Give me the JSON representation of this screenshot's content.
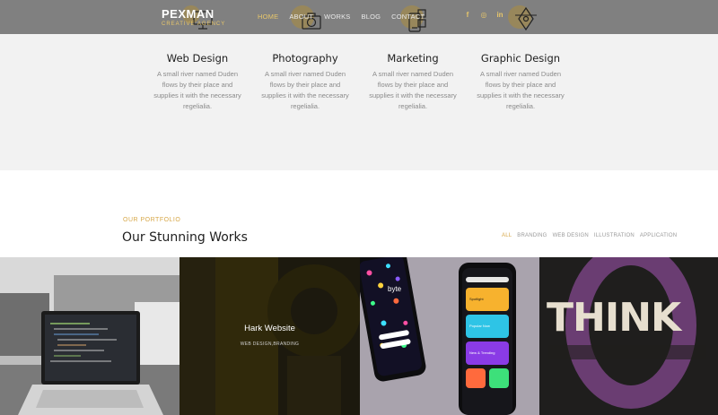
{
  "header": {
    "brand_name": "PEXMAN",
    "brand_tagline": "CREATIVE AGENCY",
    "nav": [
      "HOME",
      "ABOUT",
      "WORKS",
      "BLOG",
      "CONTACT"
    ],
    "social_icons": [
      "facebook-icon",
      "instagram-icon",
      "linkedin-icon"
    ],
    "social_glyphs": [
      "f",
      "◎",
      "in"
    ]
  },
  "services": [
    {
      "title": "Web Design",
      "text": "A small river named Duden flows by their place and supplies it with the necessary regelialia."
    },
    {
      "title": "Photography",
      "text": "A small river named Duden flows by their place and supplies it with the necessary regelialia."
    },
    {
      "title": "Marketing",
      "text": "A small river named Duden flows by their place and supplies it with the necessary regelialia."
    },
    {
      "title": "Graphic Design",
      "text": "A small river named Duden flows by their place and supplies it with the necessary regelialia."
    }
  ],
  "portfolio": {
    "kicker": "OUR PORTFOLIO",
    "title": "Our Stunning Works",
    "filters": [
      "ALL",
      "BRANDING",
      "WEB DESIGN",
      "ILLUSTRATION",
      "APPLICATION"
    ],
    "active_filter": "ALL",
    "featured_title": "Hark Website",
    "featured_categories": "WEB DESIGN,BRANDING",
    "phone_brand": "byte",
    "app_cards": [
      "Spotlight",
      "Popular Now",
      "New & Trending"
    ],
    "art_word": "THINK"
  },
  "colors": {
    "accent": "#d7a84a",
    "header_bg": "#808080",
    "services_bg": "#f2f2f2"
  }
}
